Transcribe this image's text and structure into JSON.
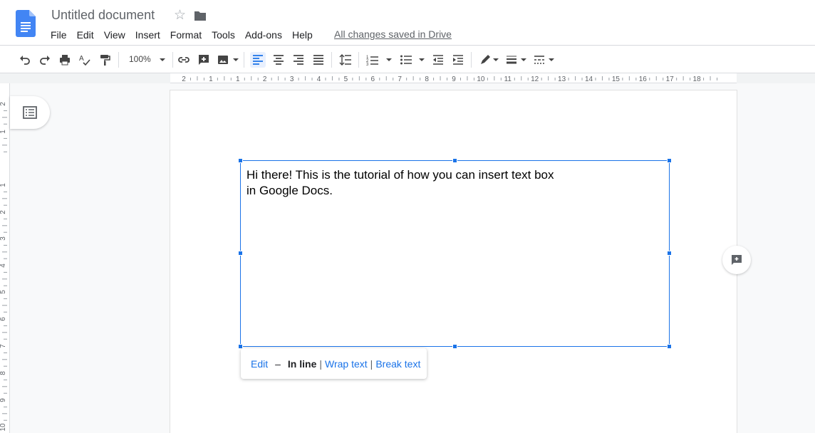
{
  "app": {
    "title": "Untitled document",
    "save_status": "All changes saved in Drive"
  },
  "menu": {
    "items": [
      "File",
      "Edit",
      "View",
      "Insert",
      "Format",
      "Tools",
      "Add-ons",
      "Help"
    ]
  },
  "toolbar": {
    "zoom": "100%",
    "icons": [
      "undo-icon",
      "redo-icon",
      "print-icon",
      "spellcheck-icon",
      "paint-format-icon",
      "link-icon",
      "add-comment-icon",
      "image-icon",
      "align-left-icon",
      "align-center-icon",
      "align-right-icon",
      "justify-icon",
      "line-spacing-icon",
      "numbered-list-icon",
      "bulleted-list-icon",
      "decrease-indent-icon",
      "increase-indent-icon",
      "border-color-icon",
      "border-weight-icon",
      "border-dash-icon"
    ]
  },
  "ruler": {
    "horizontal_labels": [
      "2",
      "1",
      "1",
      "2",
      "3",
      "4",
      "5",
      "6",
      "7",
      "8",
      "9",
      "10",
      "11",
      "12",
      "13",
      "14",
      "15",
      "16",
      "17",
      "18"
    ],
    "vertical_labels": [
      "2",
      "1",
      "1",
      "2",
      "3",
      "4",
      "5",
      "6",
      "7",
      "8",
      "9",
      "10"
    ]
  },
  "document": {
    "textbox_text": "Hi there! This is the tutorial of how you can insert text box in Google Docs."
  },
  "textbox_popup": {
    "edit": "Edit",
    "dash": "–",
    "inline": "In line",
    "wrap": "Wrap text",
    "break": "Break text",
    "separator": "|"
  },
  "colors": {
    "accent": "#1a73e8",
    "doc_blue": "#4285f4"
  }
}
